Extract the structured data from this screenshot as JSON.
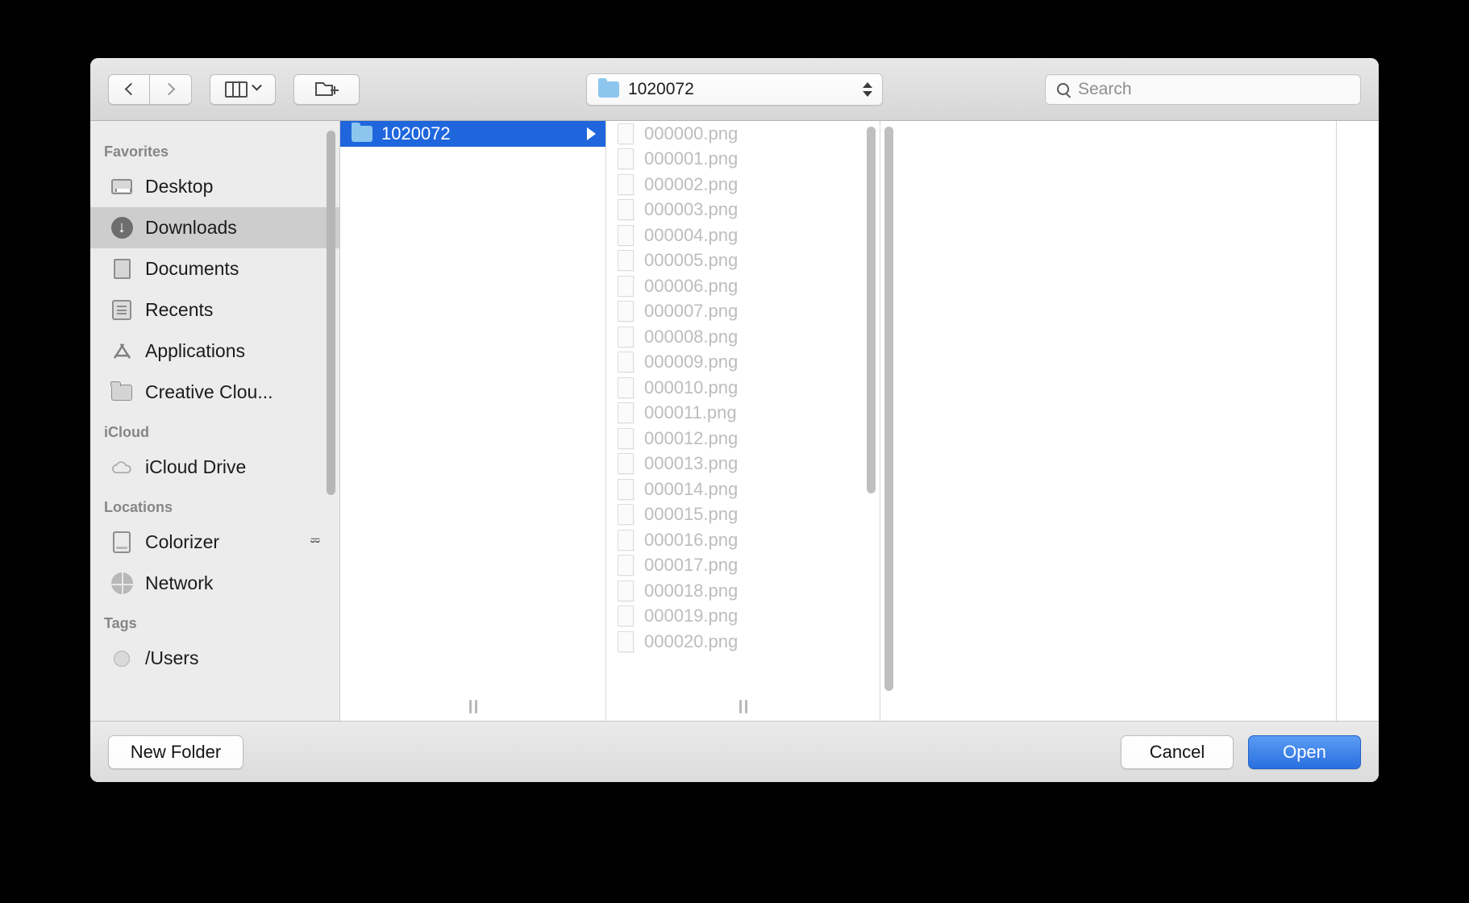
{
  "dialog": {
    "kind": "open-file-dialog"
  },
  "toolbar": {
    "back_icon": "chevron-left-icon",
    "forward_icon": "chevron-right-icon",
    "view_icon": "column-view-icon",
    "view_chevron_icon": "chevron-down-icon",
    "new_folder_icon": "new-folder-icon",
    "path": {
      "folder_icon": "folder-icon",
      "label": "1020072",
      "stepper_icon": "stepper-updown-icon"
    },
    "search": {
      "icon": "search-icon",
      "value": "",
      "placeholder": "Search"
    }
  },
  "sidebar": {
    "sections": [
      {
        "title": "Favorites",
        "items": [
          {
            "label": "Desktop",
            "icon": "desktop-icon",
            "selected": false
          },
          {
            "label": "Downloads",
            "icon": "downloads-icon",
            "selected": true
          },
          {
            "label": "Documents",
            "icon": "documents-icon",
            "selected": false
          },
          {
            "label": "Recents",
            "icon": "recents-icon",
            "selected": false
          },
          {
            "label": "Applications",
            "icon": "applications-icon",
            "selected": false
          },
          {
            "label": "Creative Clou...",
            "icon": "folder-icon",
            "selected": false
          }
        ]
      },
      {
        "title": "iCloud",
        "items": [
          {
            "label": "iCloud Drive",
            "icon": "cloud-icon",
            "selected": false
          }
        ]
      },
      {
        "title": "Locations",
        "items": [
          {
            "label": "Colorizer",
            "icon": "disk-icon",
            "selected": false,
            "eject_icon": "eject-icon"
          },
          {
            "label": "Network",
            "icon": "network-icon",
            "selected": false
          }
        ]
      },
      {
        "title": "Tags",
        "items": [
          {
            "label": "/Users",
            "icon": "tag-circle-icon",
            "selected": false
          }
        ]
      }
    ]
  },
  "browser": {
    "folder_column": {
      "rows": [
        {
          "label": "1020072",
          "icon": "folder-icon",
          "selected": true,
          "disclosure_icon": "disclosure-triangle-icon"
        }
      ]
    },
    "file_column": {
      "files": [
        {
          "name": "000000.png",
          "icon": "image-thumbnail"
        },
        {
          "name": "000001.png",
          "icon": "image-thumbnail"
        },
        {
          "name": "000002.png",
          "icon": "image-thumbnail"
        },
        {
          "name": "000003.png",
          "icon": "image-thumbnail"
        },
        {
          "name": "000004.png",
          "icon": "image-thumbnail"
        },
        {
          "name": "000005.png",
          "icon": "image-thumbnail"
        },
        {
          "name": "000006.png",
          "icon": "image-thumbnail"
        },
        {
          "name": "000007.png",
          "icon": "image-thumbnail"
        },
        {
          "name": "000008.png",
          "icon": "image-thumbnail"
        },
        {
          "name": "000009.png",
          "icon": "image-thumbnail"
        },
        {
          "name": "000010.png",
          "icon": "image-thumbnail"
        },
        {
          "name": "000011.png",
          "icon": "image-thumbnail"
        },
        {
          "name": "000012.png",
          "icon": "image-thumbnail"
        },
        {
          "name": "000013.png",
          "icon": "image-thumbnail"
        },
        {
          "name": "000014.png",
          "icon": "image-thumbnail"
        },
        {
          "name": "000015.png",
          "icon": "image-thumbnail"
        },
        {
          "name": "000016.png",
          "icon": "image-thumbnail"
        },
        {
          "name": "000017.png",
          "icon": "image-thumbnail"
        },
        {
          "name": "000018.png",
          "icon": "image-thumbnail"
        },
        {
          "name": "000019.png",
          "icon": "image-thumbnail"
        },
        {
          "name": "000020.png",
          "icon": "image-thumbnail"
        }
      ]
    }
  },
  "footer": {
    "new_folder_label": "New Folder",
    "cancel_label": "Cancel",
    "open_label": "Open"
  },
  "colors": {
    "selection_blue": "#1f66dd",
    "default_button_blue": "#2a6fe0",
    "sidebar_bg": "#ececec",
    "folder_blue": "#8cc6ee",
    "disabled_text": "#bdbdbd"
  }
}
